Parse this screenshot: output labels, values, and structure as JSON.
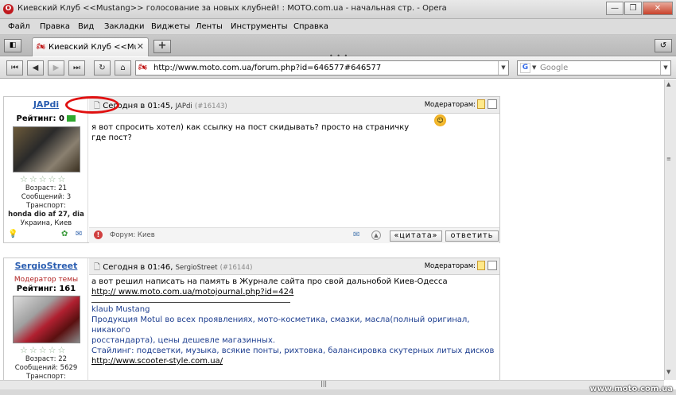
{
  "window": {
    "title": "Киевский Клуб <<Mustang>> голосование за новых клубней! : MOTO.com.ua - начальная стр. - Opera",
    "icon": "opera-logo-icon"
  },
  "menu": [
    "Файл",
    "Правка",
    "Вид",
    "Закладки",
    "Виджеты",
    "Ленты",
    "Инструменты",
    "Справка"
  ],
  "tab": {
    "title": "Киевский Клуб <<Mu...",
    "close": "✕"
  },
  "address": {
    "url": "http://www.moto.com.ua/forum.php?id=646577#646577"
  },
  "search": {
    "placeholder": "Google"
  },
  "posts": [
    {
      "author": "JAPdi",
      "rating_label": "Рейтинг: 0",
      "age": "Возраст: 21",
      "messages": "Сообщений: 3",
      "transport_label": "Транспорт:",
      "transport": "honda dio af 27, dia",
      "location": "Украина, Киев",
      "date": "Сегодня в 01:45,",
      "date_author": "JAPdi",
      "post_num": "(#16143)",
      "moderators": "Модераторам:",
      "text": "я вот спросить хотел) как ссылку на пост скидывать? просто на страничку где пост?",
      "forum": "Форум: Киев",
      "quote": "«цитата»",
      "reply": "ответить"
    },
    {
      "author": "SergioStreet",
      "role": "Модератор темы",
      "rating_label": "Рейтинг: 161",
      "age": "Возраст: 22",
      "messages": "Сообщений: 5629",
      "transport_label": "Транспорт:",
      "date": "Сегодня в 01:46,",
      "date_author": "SergioStreet",
      "post_num": "(#16144)",
      "moderators": "Модераторам:",
      "text": "а  вот решил написать на память в Журнале сайта про свой дальнобой Киев-Одесса",
      "link": "http:// www.moto.com.ua/motojournal.php?id=424",
      "sig_title": "klaub Mustang",
      "sig_line1": "Продукция Motul во всех проявлениях, мото-косметика, смазки, масла(полный оригинал, никакого",
      "sig_line2": "росстандарта), цены дешевле магазинных.",
      "sig_line3": "Стайлинг: подсветки, музыка, всякие понты, рихтовка, балансировка скутерных литых дисков",
      "sig_link": "http://www.scooter-style.com.ua/"
    }
  ],
  "watermark": "www.moto.com.ua"
}
